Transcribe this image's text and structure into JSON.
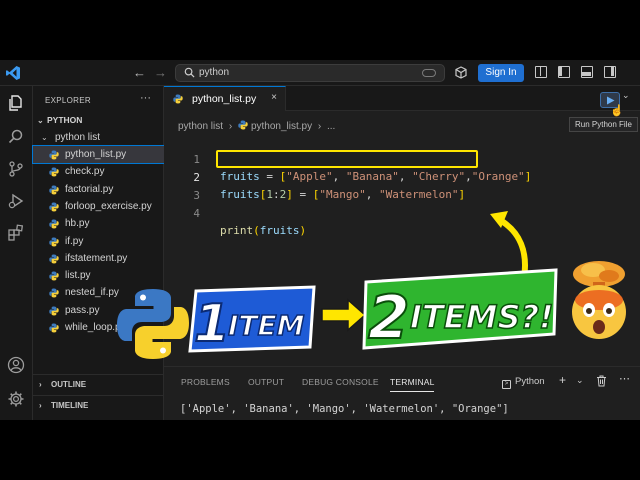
{
  "titlebar": {
    "search_text": "python",
    "signin_label": "Sign In"
  },
  "sidebar": {
    "header": "EXPLORER",
    "more": "···",
    "root": "PYTHON",
    "folder": "python list",
    "files": [
      "python_list.py",
      "check.py",
      "factorial.py",
      "forloop_exercise.py",
      "hb.py",
      "if.py",
      "ifstatement.py",
      "list.py",
      "nested_if.py",
      "pass.py",
      "while_loop.py"
    ],
    "selected_file": "python_list.py",
    "outline": "OUTLINE",
    "timeline": "TIMELINE"
  },
  "editor": {
    "tab_name": "python_list.py",
    "tab_close": "×",
    "breadcrumb": [
      "python list",
      "›",
      "python_list.py",
      "›",
      "..."
    ],
    "run_tooltip": "Run Python File",
    "line_numbers": [
      "1",
      "2",
      "3",
      "4"
    ],
    "line1": {
      "var": "fruits",
      "eq": " = ",
      "open": "[",
      "s1": "\"Apple\"",
      "c1": ", ",
      "s2": "\"Banana\"",
      "c2": ", ",
      "s3": "\"Cherry\"",
      "c3": ",",
      "s4": "\"Orange\"",
      "close": "]"
    },
    "line2": {
      "var": "fruits",
      "open": "[",
      "n1": "1",
      "colon": ":",
      "n2": "2",
      "close": "]",
      "eq": " = ",
      "lopen": "[",
      "s1": "\"Mango\"",
      "c1": ", ",
      "s2": "\"Watermelon\"",
      "lclose": "]"
    },
    "line4": {
      "fn": "print",
      "open": "(",
      "arg": "fruits",
      "close": ")"
    }
  },
  "overlay": {
    "left_number": "1",
    "left_word": "ITEM",
    "right_number": "2",
    "right_word": "ITEMS?!"
  },
  "panel": {
    "tabs": [
      "PROBLEMS",
      "OUTPUT",
      "DEBUG CONSOLE",
      "TERMINAL"
    ],
    "active_tab": "TERMINAL",
    "terminal_kind": "Python",
    "add": "+",
    "chevron": "⌄",
    "output": "['Apple', 'Banana', 'Mango', 'Watermelon', \"Orange\"]"
  },
  "colors": {
    "accent": "#0078d4",
    "signin": "#1f6fd1",
    "highlight": "#ffe600",
    "banner_blue": "#1e5bd6",
    "banner_green": "#2fb52f"
  },
  "icons": [
    "vscode-logo-icon",
    "back-arrow-icon",
    "forward-arrow-icon",
    "search-icon",
    "copilot-icon",
    "extensions-icon",
    "layout-icon",
    "explorer-icon",
    "search-sidebar-icon",
    "source-control-icon",
    "run-debug-icon",
    "extensions-sidebar-icon",
    "account-icon",
    "settings-gear-icon",
    "python-file-icon",
    "run-play-icon",
    "terminal-icon",
    "trash-icon",
    "python-logo-icon",
    "exploding-head-emoji-icon"
  ]
}
